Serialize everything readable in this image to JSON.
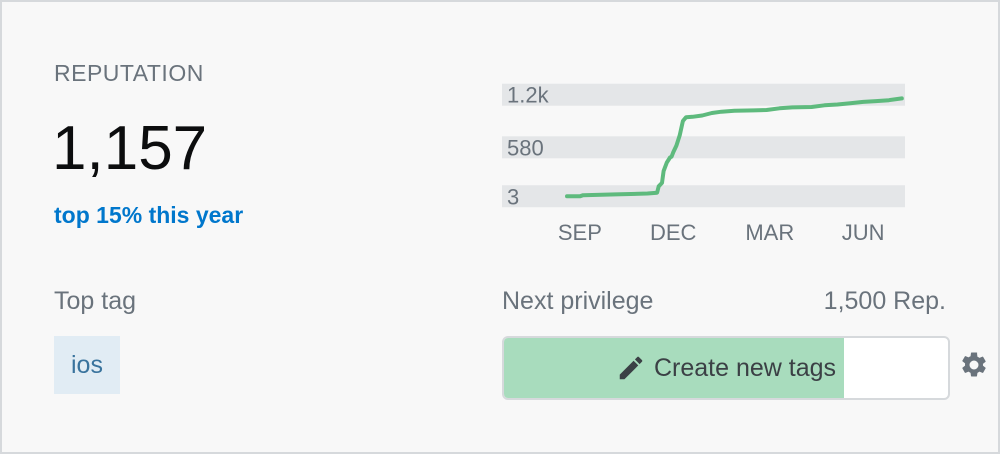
{
  "reputation": {
    "label": "REPUTATION",
    "value": "1,157",
    "rank_text": "top 15% this year"
  },
  "top_tag": {
    "label": "Top tag",
    "tag": "ios"
  },
  "next_privilege": {
    "label": "Next privilege",
    "required_rep": "1,500 Rep.",
    "name": "Create new tags",
    "progress_fraction": 0.765,
    "icon": "pencil-icon"
  },
  "settings": {
    "icon": "gear-icon"
  },
  "colors": {
    "accent_link": "#0077cc",
    "line": "#5eba7d",
    "progress_fill": "#a8dcbd",
    "tag_bg": "#e1ecf4",
    "tag_text": "#39739d"
  },
  "chart_data": {
    "type": "line",
    "y_ticks": [
      "1.2k",
      "580",
      "3"
    ],
    "y_tick_values": [
      1200,
      580,
      3
    ],
    "x_ticks": [
      "SEP",
      "DEC",
      "MAR",
      "JUN"
    ],
    "x_tick_values": [
      0.4,
      3.3,
      6.3,
      9.2
    ],
    "ylim": [
      -100,
      1350
    ],
    "xlim": [
      0,
      10.5
    ],
    "grid": "horizontal bands",
    "series": [
      {
        "values": [
          [
            0,
            3
          ],
          [
            0.4,
            3
          ],
          [
            0.5,
            15
          ],
          [
            1.5,
            25
          ],
          [
            2.5,
            35
          ],
          [
            2.8,
            45
          ],
          [
            2.85,
            120
          ],
          [
            2.95,
            160
          ],
          [
            3.0,
            300
          ],
          [
            3.1,
            400
          ],
          [
            3.2,
            460
          ],
          [
            3.25,
            470
          ],
          [
            3.3,
            520
          ],
          [
            3.4,
            600
          ],
          [
            3.5,
            720
          ],
          [
            3.6,
            890
          ],
          [
            3.7,
            935
          ],
          [
            3.9,
            940
          ],
          [
            4.2,
            955
          ],
          [
            4.5,
            985
          ],
          [
            4.8,
            1000
          ],
          [
            5.2,
            1010
          ],
          [
            5.8,
            1015
          ],
          [
            6.2,
            1020
          ],
          [
            6.6,
            1040
          ],
          [
            7.0,
            1050
          ],
          [
            7.6,
            1055
          ],
          [
            8.0,
            1075
          ],
          [
            8.4,
            1085
          ],
          [
            8.8,
            1100
          ],
          [
            9.2,
            1115
          ],
          [
            9.6,
            1125
          ],
          [
            10.0,
            1135
          ],
          [
            10.4,
            1157
          ]
        ]
      }
    ]
  }
}
